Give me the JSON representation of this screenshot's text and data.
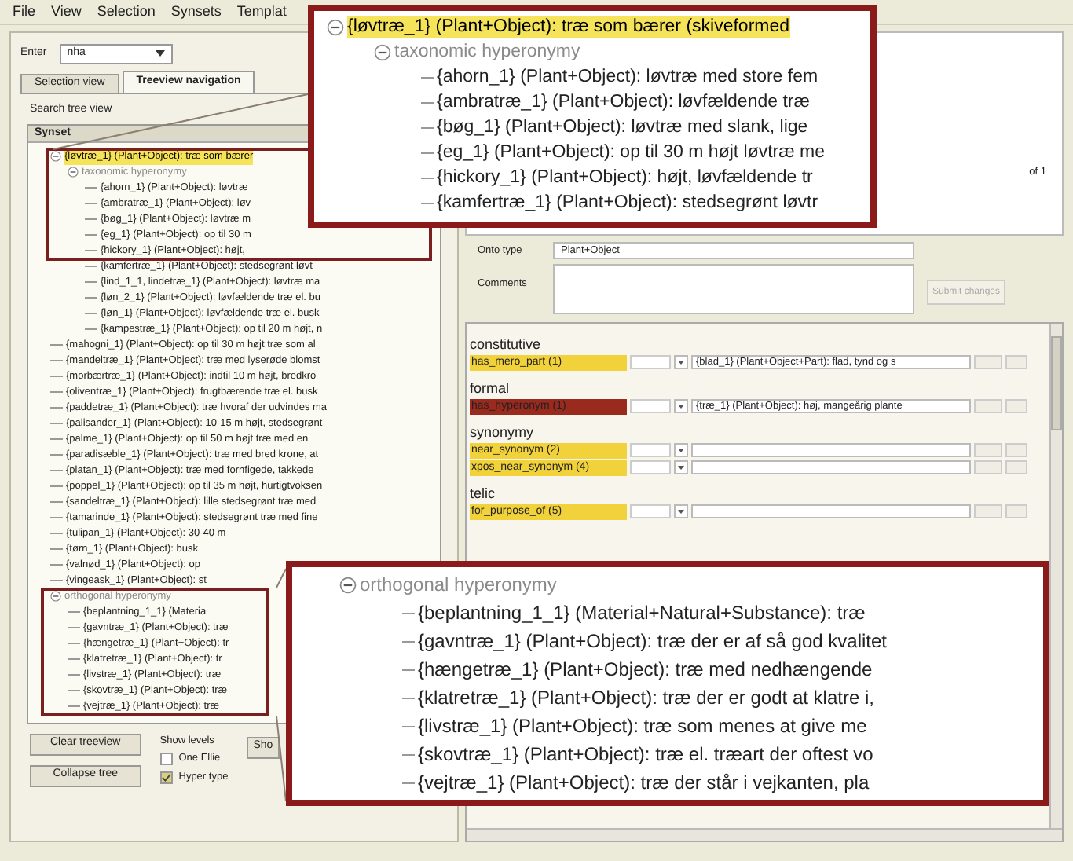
{
  "menu": [
    "File",
    "View",
    "Selection",
    "Synsets",
    "Templat"
  ],
  "left": {
    "enter_label": "Enter",
    "enter_value": "nha",
    "tabs": [
      {
        "label": "Selection view",
        "selected": false
      },
      {
        "label": "Treeview navigation",
        "selected": true
      }
    ],
    "search_label": "Search tree view",
    "tree_header": "Synset",
    "tree": [
      {
        "label": "{løvtræ_1} (Plant+Object): træ som bærer",
        "selected": true,
        "expanded": true,
        "children": [
          {
            "label": "taxonomic hyperonymy",
            "kind": "relation",
            "expanded": true,
            "children": [
              {
                "label": "{ahorn_1} (Plant+Object): løvtræ",
                "selected": false
              },
              {
                "label": "{ambratræ_1} (Plant+Object): løv",
                "selected": false
              },
              {
                "label": "{bøg_1} (Plant+Object): løvtræ m",
                "selected": false
              },
              {
                "label": "{eg_1} (Plant+Object): op til 30 m",
                "selected": false
              },
              {
                "label": "{hickory_1} (Plant+Object): højt,",
                "selected": false
              },
              {
                "label": "{kamfertræ_1} (Plant+Object): stedsegrønt løvt",
                "selected": false
              },
              {
                "label": "{lind_1_1, lindetræ_1} (Plant+Object): løvtræ ma",
                "selected": false
              },
              {
                "label": "{løn_2_1} (Plant+Object): løvfældende træ el. bu",
                "selected": false
              },
              {
                "label": "{løn_1} (Plant+Object): løvfældende træ el. busk",
                "selected": false
              },
              {
                "label": "{kampestræ_1} (Plant+Object): op til 20 m højt, n",
                "selected": false
              }
            ]
          }
        ]
      },
      {
        "label": "{mahogni_1} (Plant+Object): op til 30 m højt træ som al",
        "selected": false
      },
      {
        "label": "{mandeltræ_1} (Plant+Object): træ med lyserøde blomst",
        "selected": false
      },
      {
        "label": "{morbærtræ_1} (Plant+Object): indtil 10 m højt, bredkro",
        "selected": false
      },
      {
        "label": "{oliventræ_1} (Plant+Object): frugtbærende træ el. busk",
        "selected": false
      },
      {
        "label": "{paddetræ_1} (Plant+Object): træ hvoraf der udvindes ma",
        "selected": false
      },
      {
        "label": "{palisander_1} (Plant+Object): 10-15 m højt, stedsegrønt",
        "selected": false
      },
      {
        "label": "{palme_1} (Plant+Object): op til 50 m højt træ med en",
        "selected": false
      },
      {
        "label": "{paradisæble_1} (Plant+Object): træ med bred krone, at",
        "selected": false
      },
      {
        "label": "{platan_1} (Plant+Object): træ med fornfigede, takkede",
        "selected": false
      },
      {
        "label": "{poppel_1} (Plant+Object): op til 35 m højt, hurtigtvoksen",
        "selected": false
      },
      {
        "label": "{sandeltræ_1} (Plant+Object): lille stedsegrønt træ med",
        "selected": false
      },
      {
        "label": "{tamarinde_1} (Plant+Object): stedsegrønt træ med fine",
        "selected": false
      },
      {
        "label": "{tulipan_1} (Plant+Object): 30-40 m",
        "selected": false
      },
      {
        "label": "{tørn_1} (Plant+Object): busk",
        "selected": false
      },
      {
        "label": "{valnød_1} (Plant+Object): op",
        "selected": false
      },
      {
        "label": "{vingeask_1} (Plant+Object): st",
        "selected": false
      },
      {
        "label": "orthogonal hyperonymy",
        "kind": "relation",
        "expanded": true,
        "children": [
          {
            "label": "{beplantning_1_1} (Materia",
            "selected": false
          },
          {
            "label": "{gavntræ_1} (Plant+Object): træ",
            "selected": false
          },
          {
            "label": "{hængetræ_1} (Plant+Object): tr",
            "selected": false
          },
          {
            "label": "{klatretræ_1} (Plant+Object): tr",
            "selected": false
          },
          {
            "label": "{livstræ_1} (Plant+Object): træ",
            "selected": false
          },
          {
            "label": "{skovtræ_1} (Plant+Object): træ",
            "selected": false
          },
          {
            "label": "{vejtræ_1} (Plant+Object): træ",
            "selected": false
          }
        ]
      }
    ],
    "buttons": [
      "Clear treeview",
      "Collapse tree",
      "Sho"
    ],
    "levels_label": "Show levels",
    "checks": [
      {
        "label": "One Ellie",
        "checked": false
      },
      {
        "label": "Hyper type",
        "checked": true
      }
    ]
  },
  "right": {
    "page_label": "of 1",
    "onto_label": "Onto type",
    "onto_value": "Plant+Object",
    "comments_label": "Comments",
    "submit": "Submit changes",
    "relations": [
      {
        "title": "constitutive",
        "rows": [
          {
            "name": "has_mero_part (1)",
            "color": "#f2d23a",
            "target": "{blad_1} (Plant+Object+Part): flad, tynd og s"
          }
        ]
      },
      {
        "title": "formal",
        "rows": [
          {
            "name": "has_hyperonym (1)",
            "color": "#9a2a1e",
            "target": "{træ_1} (Plant+Object): høj, mangeårig plante"
          }
        ]
      },
      {
        "title": "synonymy",
        "rows": [
          {
            "name": "near_synonym (2)",
            "color": "#f2d23a",
            "target": ""
          },
          {
            "name": "xpos_near_synonym (4)",
            "color": "#f2d23a",
            "target": ""
          }
        ]
      },
      {
        "title": "telic",
        "rows": [
          {
            "name": "for_purpose_of (5)",
            "color": "#f2d23a",
            "target": ""
          }
        ]
      }
    ]
  },
  "callout_top": [
    {
      "label": "{løvtræ_1} (Plant+Object): træ som bærer (skiveformed",
      "selected": true,
      "expanded": true,
      "children": [
        {
          "label": "taxonomic hyperonymy",
          "kind": "relation",
          "expanded": true,
          "children": [
            {
              "label": "{ahorn_1} (Plant+Object): løvtræ med store fem",
              "selected": false
            },
            {
              "label": "{ambratræ_1} (Plant+Object): løvfældende træ",
              "selected": false
            },
            {
              "label": "{bøg_1} (Plant+Object): løvtræ med slank, lige",
              "selected": false
            },
            {
              "label": "{eg_1} (Plant+Object): op til 30 m højt løvtræ me",
              "selected": false
            },
            {
              "label": "{hickory_1} (Plant+Object): højt, løvfældende tr",
              "selected": false
            },
            {
              "label": "{kamfertræ_1} (Plant+Object): stedsegrønt løvtr",
              "selected": false
            }
          ]
        }
      ]
    }
  ],
  "callout_bottom": [
    {
      "label": "orthogonal hyperonymy",
      "kind": "relation",
      "expanded": true,
      "children": [
        {
          "label": "{beplantning_1_1} (Material+Natural+Substance): træ",
          "selected": false
        },
        {
          "label": "{gavntræ_1} (Plant+Object): træ der er af så god kvalitet",
          "selected": false
        },
        {
          "label": "{hængetræ_1} (Plant+Object): træ med nedhængende",
          "selected": false
        },
        {
          "label": "{klatretræ_1} (Plant+Object): træ der er godt at klatre i,",
          "selected": false
        },
        {
          "label": "{livstræ_1} (Plant+Object): træ som menes at give me",
          "selected": false
        },
        {
          "label": "{skovtræ_1} (Plant+Object): træ el. træart der oftest vo",
          "selected": false
        },
        {
          "label": "{vejtræ_1} (Plant+Object): træ der står i vejkanten, pla",
          "selected": false
        }
      ]
    }
  ]
}
